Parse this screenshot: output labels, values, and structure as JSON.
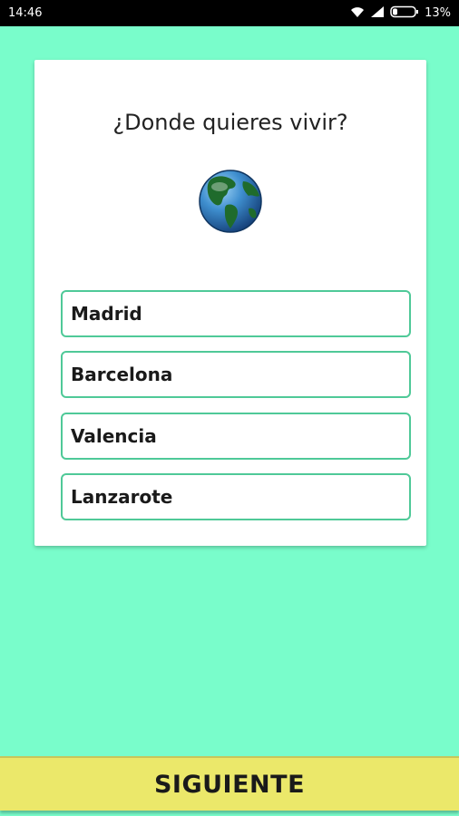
{
  "status_bar": {
    "time": "14:46",
    "battery": "13%",
    "icons": [
      "wifi-icon",
      "signal-icon",
      "battery-icon"
    ]
  },
  "card": {
    "question": "¿Donde quieres vivir?",
    "image_icon": "globe-icon"
  },
  "options": [
    {
      "label": "Madrid"
    },
    {
      "label": "Barcelona"
    },
    {
      "label": "Valencia"
    },
    {
      "label": "Lanzarote"
    }
  ],
  "footer": {
    "next_label": "SIGUIENTE"
  },
  "colors": {
    "background": "#79fdcb",
    "option_border": "#4fc998",
    "button": "#ebe86a"
  }
}
